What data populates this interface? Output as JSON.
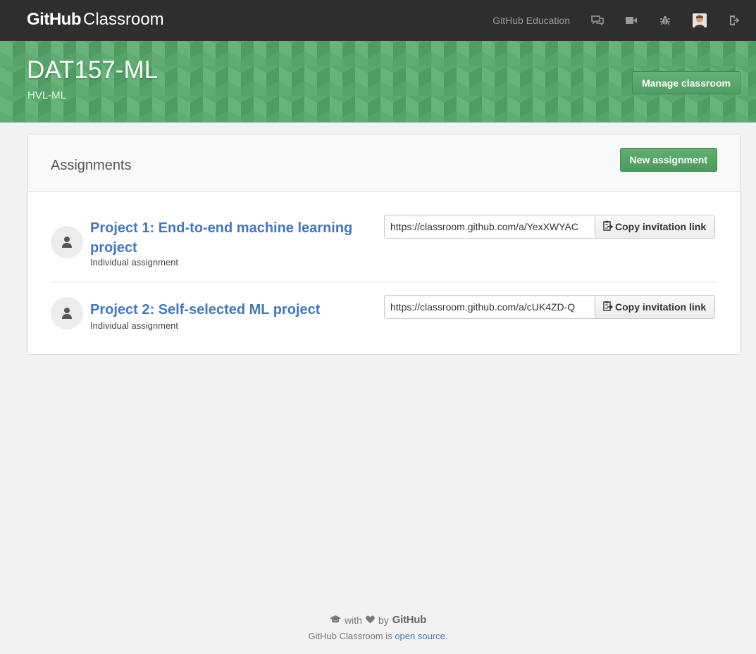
{
  "brand": {
    "bold": "GitHub",
    "light": "Classroom"
  },
  "nav": {
    "education_link": "GitHub Education",
    "icons": [
      "chat-icon",
      "video-icon",
      "bug-icon",
      "avatar",
      "sign-out-icon"
    ]
  },
  "hero": {
    "title": "DAT157-ML",
    "subtitle": "HVL-ML",
    "manage_button": "Manage classroom",
    "color": "#5aa86e"
  },
  "assignments": {
    "heading": "Assignments",
    "new_button": "New assignment",
    "copy_label": "Copy invitation link",
    "items": [
      {
        "title": "Project 1: End-to-end machine learning project",
        "type": "Individual assignment",
        "invite_url": "https://classroom.github.com/a/YexXWYAC"
      },
      {
        "title": "Project 2: Self-selected ML project",
        "type": "Individual assignment",
        "invite_url": "https://classroom.github.com/a/cUK4ZD-Q"
      }
    ]
  },
  "footer": {
    "with": "with",
    "by": "by",
    "github": "GitHub",
    "text_before_link": "GitHub Classroom is ",
    "link": "open source",
    "text_after_link": "."
  },
  "colors": {
    "link": "#4078c0",
    "primary_button": "#55a665",
    "topbar": "#2e2e2e"
  }
}
